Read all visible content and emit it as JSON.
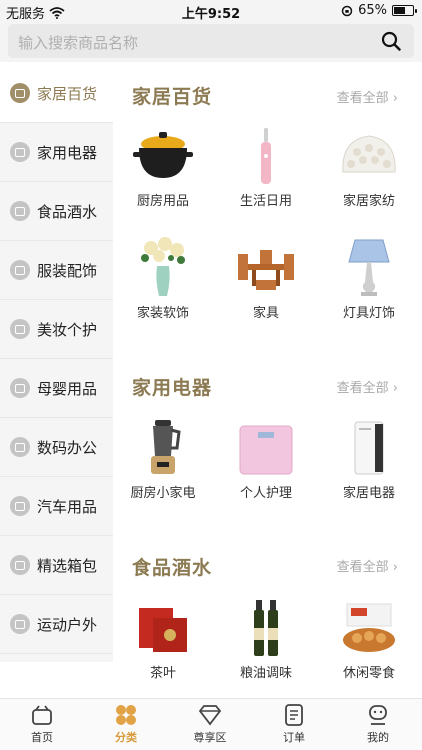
{
  "status_bar": {
    "carrier": "无服务",
    "time": "上午9:52",
    "battery": "65%",
    "battery_level": 0.65
  },
  "search": {
    "placeholder": "输入搜索商品名称",
    "icon": "search-icon"
  },
  "sidebar": {
    "items": [
      {
        "label": "家居百货",
        "icon": "home-goods-icon",
        "active": true
      },
      {
        "label": "家用电器",
        "icon": "appliance-icon",
        "active": false
      },
      {
        "label": "食品酒水",
        "icon": "wine-glass-icon",
        "active": false
      },
      {
        "label": "服装配饰",
        "icon": "shirt-icon",
        "active": false
      },
      {
        "label": "美妆个护",
        "icon": "cosmetics-icon",
        "active": false
      },
      {
        "label": "母婴用品",
        "icon": "baby-bottle-icon",
        "active": false
      },
      {
        "label": "数码办公",
        "icon": "digital-icon",
        "active": false
      },
      {
        "label": "汽车用品",
        "icon": "car-icon",
        "active": false
      },
      {
        "label": "精选箱包",
        "icon": "bag-icon",
        "active": false
      },
      {
        "label": "运动户外",
        "icon": "sports-icon",
        "active": false
      }
    ]
  },
  "sections": [
    {
      "title": "家居百货",
      "view_all": "查看全部",
      "items": [
        {
          "label": "厨房用品",
          "icon": "casserole-pot-icon"
        },
        {
          "label": "生活日用",
          "icon": "electric-toothbrush-icon"
        },
        {
          "label": "家居家纺",
          "icon": "pillow-icon"
        },
        {
          "label": "家装软饰",
          "icon": "flower-vase-icon"
        },
        {
          "label": "家具",
          "icon": "table-chairs-icon"
        },
        {
          "label": "灯具灯饰",
          "icon": "table-lamp-icon"
        }
      ]
    },
    {
      "title": "家用电器",
      "view_all": "查看全部",
      "items": [
        {
          "label": "厨房小家电",
          "icon": "blender-icon"
        },
        {
          "label": "个人护理",
          "icon": "bathroom-scale-icon"
        },
        {
          "label": "家居电器",
          "icon": "air-purifier-icon"
        }
      ]
    },
    {
      "title": "食品酒水",
      "view_all": "查看全部",
      "items": [
        {
          "label": "茶叶",
          "icon": "tea-gift-box-icon"
        },
        {
          "label": "粮油调味",
          "icon": "oil-bottles-icon"
        },
        {
          "label": "休闲零食",
          "icon": "snack-box-icon"
        }
      ]
    }
  ],
  "tabbar": {
    "items": [
      {
        "label": "首页",
        "icon": "home-icon",
        "active": false
      },
      {
        "label": "分类",
        "icon": "category-icon",
        "active": true
      },
      {
        "label": "尊享区",
        "icon": "diamond-icon",
        "active": false
      },
      {
        "label": "订单",
        "icon": "order-icon",
        "active": false
      },
      {
        "label": "我的",
        "icon": "profile-icon",
        "active": false
      }
    ]
  },
  "colors": {
    "accent": "#8c7a52",
    "tab_active": "#d89a3a",
    "sidebar_bg": "#f5f5f5"
  }
}
